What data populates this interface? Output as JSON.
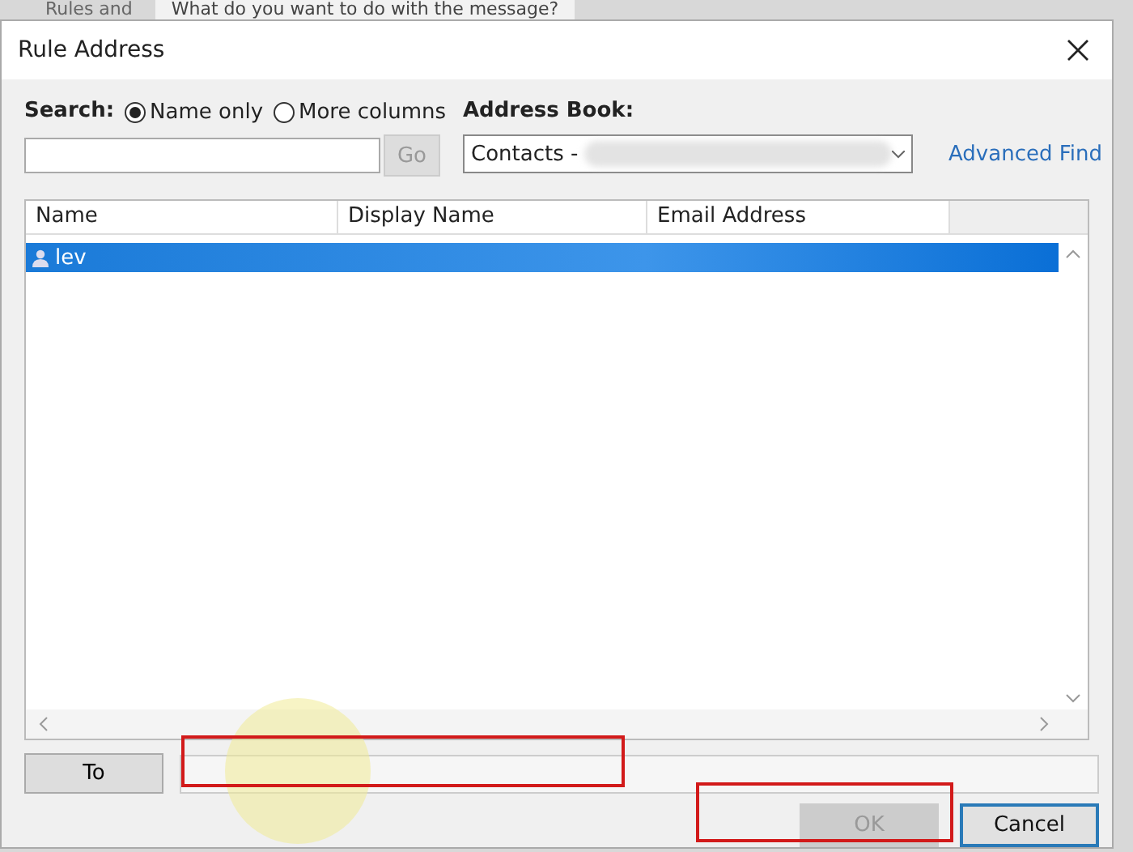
{
  "background_window": {
    "tab": "Rules and",
    "question": "What do you want to do with the message?"
  },
  "window": {
    "title": "Rule Address"
  },
  "search": {
    "label": "Search:",
    "options": [
      {
        "label": "Name only",
        "selected": true
      },
      {
        "label": "More columns",
        "selected": false
      }
    ],
    "button": "Go"
  },
  "address_book": {
    "label": "Address Book:",
    "value": "Contacts -",
    "link": "Advanced Find"
  },
  "table": {
    "columns": [
      "Name",
      "Display Name",
      "Email Address"
    ],
    "rows": [
      {
        "name": "lev",
        "selected": true
      }
    ]
  },
  "to_button": "To",
  "buttons": [
    {
      "label": "OK",
      "disabled": true
    },
    {
      "label": "Cancel",
      "disabled": false
    }
  ]
}
